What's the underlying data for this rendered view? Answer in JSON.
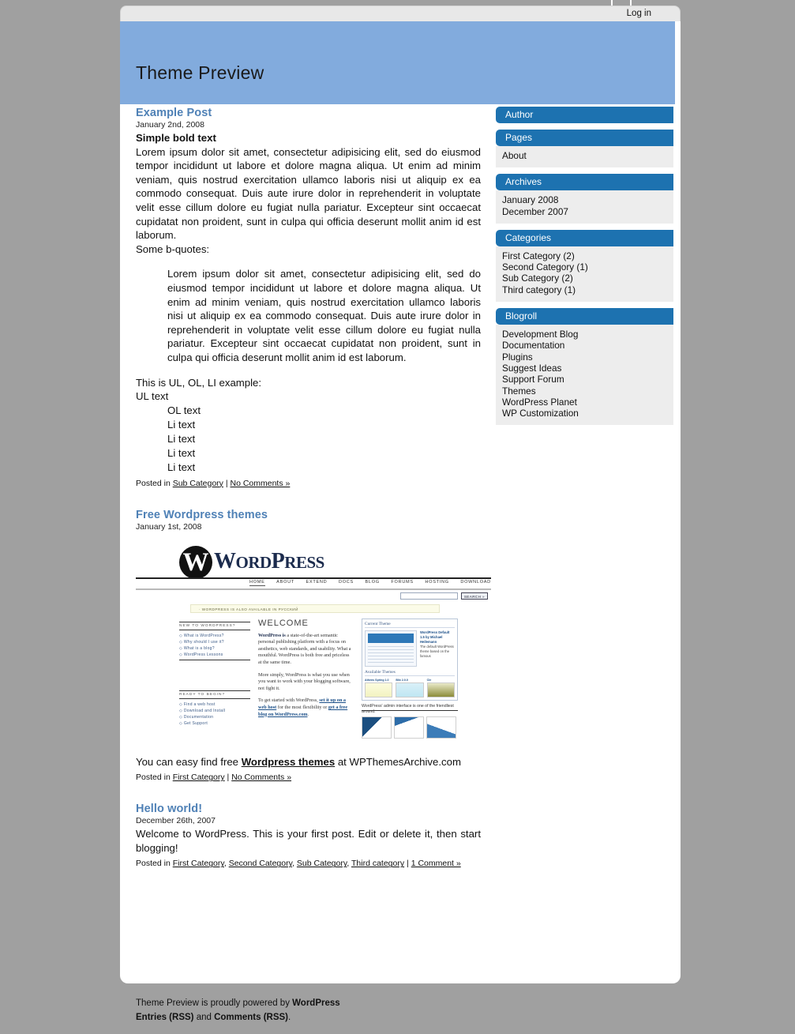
{
  "admin_bar": {
    "login_label": "Log in"
  },
  "header": {
    "blog_title": "Theme Preview"
  },
  "posts": [
    {
      "title": "Example Post",
      "date": "January 2nd, 2008",
      "bold_head": "Simple bold text",
      "paragraph": "Lorem ipsum dolor sit amet, consectetur adipisicing elit, sed do eiusmod tempor incididunt ut labore et dolore magna aliqua. Ut enim ad minim veniam, quis nostrud exercitation ullamco laboris nisi ut aliquip ex ea commodo consequat. Duis aute irure dolor in reprehenderit in voluptate velit esse cillum dolore eu fugiat nulla pariatur. Excepteur sint occaecat cupidatat non proident, sunt in culpa qui officia deserunt mollit anim id est laborum.",
      "quote_intro": "Some b-quotes:",
      "blockquote": "Lorem ipsum dolor sit amet, consectetur adipisicing elit, sed do eiusmod tempor incididunt ut labore et dolore magna aliqua. Ut enim ad minim veniam, quis nostrud exercitation ullamco laboris nisi ut aliquip ex ea commodo consequat. Duis aute irure dolor in reprehenderit in voluptate velit esse cillum dolore eu fugiat nulla pariatur. Excepteur sint occaecat cupidatat non proident, sunt in culpa qui officia deserunt mollit anim id est laborum.",
      "list_intro": "This is UL, OL, LI example:",
      "ul_item": "UL text",
      "ol_items": [
        "OL text",
        "Li text",
        "Li text",
        "Li text",
        "Li text"
      ],
      "meta_prefix": "Posted in ",
      "meta_categories": [
        "Sub Category"
      ],
      "meta_separator": " | ",
      "meta_comments": "No Comments »"
    },
    {
      "title": "Free Wordpress themes",
      "date": "January 1st, 2008",
      "caption_before": "You can easy find free ",
      "caption_link": "Wordpress themes",
      "caption_after": " at WPThemesArchive.com",
      "meta_prefix": "Posted in ",
      "meta_categories": [
        "First Category"
      ],
      "meta_separator": " | ",
      "meta_comments": "No Comments »"
    },
    {
      "title": "Hello world!",
      "date": "December 26th, 2007",
      "paragraph": "Welcome to WordPress. This is your first post. Edit or delete it, then start blogging!",
      "meta_prefix": "Posted in ",
      "meta_categories": [
        "First Category",
        "Second Category",
        "Sub Category",
        "Third category"
      ],
      "meta_separator": " | ",
      "meta_comments": "1 Comment »"
    }
  ],
  "wp_screenshot": {
    "logo_mark": "W",
    "wordmark_w": "W",
    "wordmark_ord": "ORD",
    "wordmark_p": "P",
    "wordmark_ress": "RESS",
    "nav": [
      "HOME",
      "ABOUT",
      "EXTEND",
      "DOCS",
      "BLOG",
      "FORUMS",
      "HOSTING",
      "DOWNLOAD"
    ],
    "search_button": "SEARCH »",
    "notice": "· WORDPRESS IS ALSO AVAILABLE IN РУССКИЙ",
    "left_heading_1": "NEW TO WORDPRESS?",
    "left_links_1": [
      "What is WordPress?",
      "Why should I use it?",
      "What is a blog?",
      "WordPress Lessons"
    ],
    "left_heading_2": "READY TO BEGIN?",
    "left_links_2": [
      "Find a web host",
      "Download and Install",
      "Documentation",
      "Get Support"
    ],
    "welcome": "WELCOME",
    "para_1_bold": "WordPress is",
    "para_1_rest": " a state-of-the-art semantic personal publishing platform with a focus on aesthetics, web standards, and usability. What a mouthful. WordPress is both free and priceless at the same time.",
    "para_2": "More simply, WordPress is what you use when you want to work with your blogging software, not fight it.",
    "para_3_start": "To get started with WordPress, ",
    "para_3_link1": "set it up on a web host",
    "para_3_mid": " for the most flexibility or ",
    "para_3_link2": "get a free blog on WordPress.com",
    "para_3_end": ".",
    "current_theme_label": "Current Theme",
    "current_theme_name": "WordPress Default 1.5 by Michael Heilemann",
    "current_theme_desc": "The default WordPress theme based on the famous",
    "available_themes_label": "Available Themes",
    "available_themes": [
      "Athens Spring 1.0",
      "Blix 2.0.0",
      "Cle"
    ],
    "admin_caption": "WordPress' admin interface is one of the friendliest around."
  },
  "sidebar": {
    "widgets": [
      {
        "title": "Author",
        "items": []
      },
      {
        "title": "Pages",
        "items": [
          "About"
        ]
      },
      {
        "title": "Archives",
        "items": [
          "January 2008",
          "December 2007"
        ]
      },
      {
        "title": "Categories",
        "items": [
          "First Category (2)",
          "Second Category (1)",
          "Sub Category (2)",
          "Third category (1)"
        ]
      },
      {
        "title": "Blogroll",
        "items": [
          "Development Blog",
          "Documentation",
          "Plugins",
          "Suggest Ideas",
          "Support Forum",
          "Themes",
          "WordPress Planet",
          "WP Customization"
        ]
      }
    ]
  },
  "footer": {
    "powered_prefix": "Theme Preview is proudly powered by ",
    "powered_link": "WordPress",
    "entries_link": "Entries (RSS)",
    "and_text": " and ",
    "comments_link": "Comments (RSS)",
    "period": "."
  },
  "colors": {
    "page_background": "#a0a0a0",
    "header_blue": "#82abdd",
    "widget_blue": "#1d72b0",
    "widget_body": "#ededed",
    "post_title": "#4f81b6"
  }
}
